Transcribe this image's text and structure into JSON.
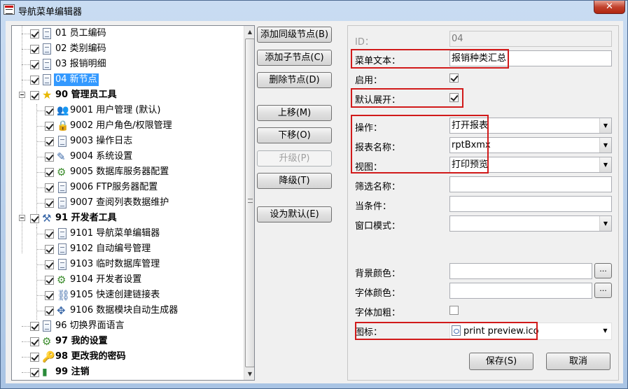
{
  "window": {
    "title": "导航菜单编辑器",
    "close_label": "✕"
  },
  "tree": {
    "items": [
      {
        "label": "01 员工编码",
        "bold": false,
        "selected": false,
        "icon": "document-icon"
      },
      {
        "label": "02 类别编码",
        "bold": false,
        "selected": false,
        "icon": "document-icon"
      },
      {
        "label": "03 报销明细",
        "bold": false,
        "selected": false,
        "icon": "document-icon"
      },
      {
        "label": "04 新节点",
        "bold": false,
        "selected": true,
        "icon": "document-icon"
      },
      {
        "label": "90 管理员工具",
        "bold": true,
        "selected": false,
        "icon": "star-icon"
      },
      {
        "label": "9001 用户管理 (默认)",
        "bold": false,
        "selected": false,
        "icon": "users-icon"
      },
      {
        "label": "9002 用户角色/权限管理",
        "bold": false,
        "selected": false,
        "icon": "lock-icon"
      },
      {
        "label": "9003 操作日志",
        "bold": false,
        "selected": false,
        "icon": "document-icon"
      },
      {
        "label": "9004 系统设置",
        "bold": false,
        "selected": false,
        "icon": "edit-document-icon"
      },
      {
        "label": "9005 数据库服务器配置",
        "bold": false,
        "selected": false,
        "icon": "gear-icon"
      },
      {
        "label": "9006 FTP服务器配置",
        "bold": false,
        "selected": false,
        "icon": "document-icon"
      },
      {
        "label": "9007 查阅列表数据维护",
        "bold": false,
        "selected": false,
        "icon": "document-icon"
      },
      {
        "label": "91 开发者工具",
        "bold": true,
        "selected": false,
        "icon": "tools-icon"
      },
      {
        "label": "9101 导航菜单编辑器",
        "bold": false,
        "selected": false,
        "icon": "form-icon"
      },
      {
        "label": "9102 自动编号管理",
        "bold": false,
        "selected": false,
        "icon": "document-icon"
      },
      {
        "label": "9103 临时数据库管理",
        "bold": false,
        "selected": false,
        "icon": "document-icon"
      },
      {
        "label": "9104 开发者设置",
        "bold": false,
        "selected": false,
        "icon": "gear-icon"
      },
      {
        "label": "9105 快速创建链接表",
        "bold": false,
        "selected": false,
        "icon": "link-icon"
      },
      {
        "label": "9106 数据模块自动生成器",
        "bold": false,
        "selected": false,
        "icon": "generator-icon"
      },
      {
        "label": "96 切换界面语言",
        "bold": false,
        "selected": false,
        "icon": "document-icon"
      },
      {
        "label": "97 我的设置",
        "bold": true,
        "selected": false,
        "icon": "gear-icon"
      },
      {
        "label": "98 更改我的密码",
        "bold": true,
        "selected": false,
        "icon": "key-icon"
      },
      {
        "label": "99 注销",
        "bold": true,
        "selected": false,
        "icon": "exit-icon"
      }
    ]
  },
  "buttons": {
    "add_sibling": "添加同级节点(B)",
    "add_child": "添加子节点(C)",
    "delete_node": "删除节点(D)",
    "move_up": "上移(M)",
    "move_down": "下移(O)",
    "promote": "升级(P)",
    "demote": "降级(T)",
    "set_default": "设为默认(E)",
    "save": "保存(S)",
    "cancel": "取消"
  },
  "form": {
    "id_label": "ID：",
    "id_value": "04",
    "menu_text_label": "菜单文本：",
    "menu_text_value": "报销种类汇总",
    "enabled_label": "启用：",
    "enabled": true,
    "default_expand_label": "默认展开：",
    "default_expand": true,
    "action_label": "操作：",
    "action_value": "打开报表",
    "report_name_label": "报表名称：",
    "report_name_value": "rptBxmx",
    "view_label": "视图：",
    "view_value": "打印预览",
    "filter_label": "筛选名称：",
    "filter_value": "",
    "condition_label": "当条件：",
    "condition_value": "",
    "window_mode_label": "窗口模式：",
    "window_mode_value": "",
    "bg_color_label": "背景颜色：",
    "bg_color_value": "",
    "font_color_label": "字体颜色：",
    "font_color_value": "",
    "font_bold_label": "字体加粗：",
    "font_bold": false,
    "icon_label": "图标：",
    "icon_value": "print preview.ico",
    "dots": "..."
  },
  "colors": {
    "highlight": "#d11a1a",
    "selection": "#3399ff"
  }
}
